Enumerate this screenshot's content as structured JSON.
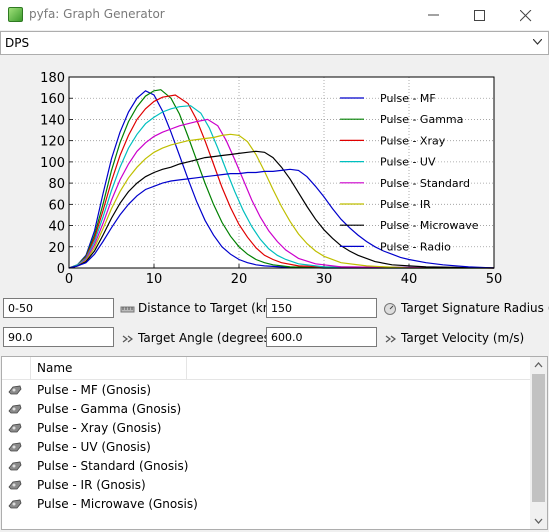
{
  "window": {
    "title": "pyfa: Graph Generator"
  },
  "graph_select": {
    "value": "DPS"
  },
  "colors": {
    "mf": "#0000cc",
    "gamma": "#008000",
    "xray": "#e00000",
    "uv": "#00bfbf",
    "standard": "#cc00cc",
    "ir": "#bfbf00",
    "microwave": "#000000",
    "radio": "#0000cc"
  },
  "chart_data": {
    "type": "line",
    "xlim": [
      0,
      50
    ],
    "ylim": [
      0,
      180
    ],
    "x_ticks": [
      "0",
      "10",
      "20",
      "30",
      "40",
      "50"
    ],
    "y_ticks": [
      "0",
      "20",
      "40",
      "60",
      "80",
      "100",
      "120",
      "140",
      "160",
      "180"
    ],
    "grid": true,
    "legend_position": "top-right",
    "series": [
      {
        "name": "Pulse - MF",
        "color": "#0000cc",
        "points": [
          [
            0,
            0
          ],
          [
            1,
            3
          ],
          [
            2,
            12
          ],
          [
            3,
            35
          ],
          [
            4,
            70
          ],
          [
            5,
            103
          ],
          [
            6,
            128
          ],
          [
            7,
            147
          ],
          [
            8,
            160
          ],
          [
            9,
            167
          ],
          [
            10,
            163
          ],
          [
            11,
            148
          ],
          [
            12,
            128
          ],
          [
            13,
            106
          ],
          [
            14,
            84
          ],
          [
            15,
            63
          ],
          [
            16,
            45
          ],
          [
            17,
            31
          ],
          [
            18,
            20
          ],
          [
            19,
            13
          ],
          [
            20,
            8
          ],
          [
            21,
            5
          ],
          [
            22,
            3
          ],
          [
            23,
            2
          ],
          [
            25,
            1
          ],
          [
            30,
            0
          ],
          [
            50,
            0
          ]
        ]
      },
      {
        "name": "Pulse - Gamma",
        "color": "#008000",
        "points": [
          [
            0,
            0
          ],
          [
            1,
            3
          ],
          [
            2,
            11
          ],
          [
            3,
            31
          ],
          [
            4,
            60
          ],
          [
            5,
            92
          ],
          [
            6,
            118
          ],
          [
            7,
            138
          ],
          [
            8,
            152
          ],
          [
            9,
            162
          ],
          [
            10,
            167
          ],
          [
            10.8,
            168
          ],
          [
            12,
            160
          ],
          [
            13,
            145
          ],
          [
            14,
            124
          ],
          [
            15,
            102
          ],
          [
            16,
            80
          ],
          [
            17,
            60
          ],
          [
            18,
            43
          ],
          [
            19,
            30
          ],
          [
            20,
            20
          ],
          [
            21,
            13
          ],
          [
            22,
            8
          ],
          [
            23,
            5
          ],
          [
            24,
            3
          ],
          [
            26,
            1
          ],
          [
            30,
            0
          ],
          [
            50,
            0
          ]
        ]
      },
      {
        "name": "Pulse - Xray",
        "color": "#e00000",
        "points": [
          [
            0,
            0
          ],
          [
            1,
            3
          ],
          [
            2,
            10
          ],
          [
            3,
            28
          ],
          [
            4,
            54
          ],
          [
            5,
            82
          ],
          [
            6,
            106
          ],
          [
            7,
            125
          ],
          [
            8,
            140
          ],
          [
            9,
            150
          ],
          [
            10,
            157
          ],
          [
            11,
            161
          ],
          [
            12.5,
            163
          ],
          [
            14,
            155
          ],
          [
            15,
            140
          ],
          [
            16,
            120
          ],
          [
            17,
            98
          ],
          [
            18,
            76
          ],
          [
            19,
            57
          ],
          [
            20,
            41
          ],
          [
            21,
            29
          ],
          [
            22,
            19
          ],
          [
            23,
            12
          ],
          [
            24,
            8
          ],
          [
            25,
            5
          ],
          [
            27,
            2
          ],
          [
            30,
            1
          ],
          [
            50,
            0
          ]
        ]
      },
      {
        "name": "Pulse - UV",
        "color": "#00bfbf",
        "points": [
          [
            0,
            0
          ],
          [
            1,
            3
          ],
          [
            2,
            9
          ],
          [
            3,
            25
          ],
          [
            4,
            48
          ],
          [
            5,
            73
          ],
          [
            6,
            95
          ],
          [
            7,
            113
          ],
          [
            8,
            126
          ],
          [
            9,
            136
          ],
          [
            10,
            142
          ],
          [
            11,
            147
          ],
          [
            12,
            150
          ],
          [
            13,
            152
          ],
          [
            14.3,
            153
          ],
          [
            15.5,
            146
          ],
          [
            16.5,
            132
          ],
          [
            17.5,
            113
          ],
          [
            18.5,
            92
          ],
          [
            19.5,
            72
          ],
          [
            20.5,
            54
          ],
          [
            21.5,
            39
          ],
          [
            22.5,
            27
          ],
          [
            23.5,
            18
          ],
          [
            24.5,
            12
          ],
          [
            25.5,
            8
          ],
          [
            27,
            4
          ],
          [
            30,
            1
          ],
          [
            50,
            0
          ]
        ]
      },
      {
        "name": "Pulse - Standard",
        "color": "#cc00cc",
        "points": [
          [
            0,
            0
          ],
          [
            1,
            2
          ],
          [
            2,
            8
          ],
          [
            3,
            22
          ],
          [
            4,
            42
          ],
          [
            5,
            64
          ],
          [
            6,
            83
          ],
          [
            7,
            98
          ],
          [
            8,
            110
          ],
          [
            9,
            118
          ],
          [
            10,
            124
          ],
          [
            11,
            128
          ],
          [
            12,
            131
          ],
          [
            13,
            134
          ],
          [
            14,
            136
          ],
          [
            15,
            138
          ],
          [
            16.3,
            140
          ],
          [
            17.5,
            134
          ],
          [
            18.5,
            120
          ],
          [
            19.5,
            102
          ],
          [
            20.5,
            83
          ],
          [
            21.5,
            64
          ],
          [
            22.5,
            48
          ],
          [
            23.5,
            35
          ],
          [
            24.5,
            25
          ],
          [
            25.5,
            17
          ],
          [
            27,
            9
          ],
          [
            29,
            4
          ],
          [
            32,
            1
          ],
          [
            50,
            0
          ]
        ]
      },
      {
        "name": "Pulse - IR",
        "color": "#bfbf00",
        "points": [
          [
            0,
            0
          ],
          [
            1,
            2
          ],
          [
            2,
            7
          ],
          [
            3,
            19
          ],
          [
            4,
            37
          ],
          [
            5,
            56
          ],
          [
            6,
            72
          ],
          [
            7,
            85
          ],
          [
            8,
            95
          ],
          [
            9,
            103
          ],
          [
            10,
            109
          ],
          [
            11,
            113
          ],
          [
            12,
            116
          ],
          [
            13,
            118
          ],
          [
            14,
            120
          ],
          [
            15,
            121
          ],
          [
            16,
            122
          ],
          [
            17,
            123
          ],
          [
            18,
            125
          ],
          [
            19,
            126
          ],
          [
            20,
            125
          ],
          [
            21,
            119
          ],
          [
            22,
            107
          ],
          [
            23,
            91
          ],
          [
            24,
            74
          ],
          [
            25,
            58
          ],
          [
            26,
            44
          ],
          [
            27,
            32
          ],
          [
            28,
            23
          ],
          [
            29,
            16
          ],
          [
            30,
            11
          ],
          [
            32,
            5
          ],
          [
            35,
            2
          ],
          [
            40,
            0
          ],
          [
            50,
            0
          ]
        ]
      },
      {
        "name": "Pulse - Microwave",
        "color": "#000000",
        "points": [
          [
            0,
            0
          ],
          [
            1,
            2
          ],
          [
            2,
            6
          ],
          [
            3,
            16
          ],
          [
            4,
            31
          ],
          [
            5,
            47
          ],
          [
            6,
            61
          ],
          [
            7,
            72
          ],
          [
            8,
            80
          ],
          [
            9,
            86
          ],
          [
            10,
            90
          ],
          [
            11,
            93
          ],
          [
            12,
            95
          ],
          [
            13,
            98
          ],
          [
            14,
            100
          ],
          [
            15,
            102
          ],
          [
            16,
            104
          ],
          [
            17,
            105
          ],
          [
            18,
            106
          ],
          [
            19,
            107
          ],
          [
            20,
            108
          ],
          [
            21,
            109
          ],
          [
            22,
            110
          ],
          [
            23,
            109
          ],
          [
            24,
            104
          ],
          [
            25,
            95
          ],
          [
            26,
            84
          ],
          [
            27,
            71
          ],
          [
            28,
            58
          ],
          [
            29,
            46
          ],
          [
            30,
            36
          ],
          [
            31,
            28
          ],
          [
            32,
            21
          ],
          [
            33,
            16
          ],
          [
            34,
            12
          ],
          [
            36,
            6
          ],
          [
            38,
            3
          ],
          [
            42,
            1
          ],
          [
            50,
            0
          ]
        ]
      },
      {
        "name": "Pulse - Radio",
        "color": "#0000cc",
        "points": [
          [
            0,
            0
          ],
          [
            1,
            2
          ],
          [
            2,
            5
          ],
          [
            3,
            13
          ],
          [
            4,
            25
          ],
          [
            5,
            38
          ],
          [
            6,
            50
          ],
          [
            7,
            60
          ],
          [
            8,
            68
          ],
          [
            9,
            74
          ],
          [
            10,
            77
          ],
          [
            11,
            80
          ],
          [
            12,
            82
          ],
          [
            13,
            83
          ],
          [
            14,
            84
          ],
          [
            15,
            85
          ],
          [
            16,
            86
          ],
          [
            17,
            87
          ],
          [
            18,
            88
          ],
          [
            19,
            89
          ],
          [
            20,
            89
          ],
          [
            21,
            90
          ],
          [
            22,
            90
          ],
          [
            23,
            91
          ],
          [
            24,
            91
          ],
          [
            25,
            92
          ],
          [
            26,
            93
          ],
          [
            27,
            92
          ],
          [
            28,
            86
          ],
          [
            29,
            77
          ],
          [
            30,
            67
          ],
          [
            31,
            56
          ],
          [
            32,
            46
          ],
          [
            33,
            38
          ],
          [
            34,
            31
          ],
          [
            35,
            25
          ],
          [
            36,
            20
          ],
          [
            37,
            16
          ],
          [
            38,
            13
          ],
          [
            39,
            10
          ],
          [
            40,
            8
          ],
          [
            42,
            5
          ],
          [
            44,
            3
          ],
          [
            47,
            1
          ],
          [
            50,
            0
          ]
        ]
      }
    ]
  },
  "controls": {
    "distance": {
      "value": "0-50",
      "label": "Distance to Target (km)"
    },
    "sig_radius": {
      "value": "150",
      "label": "Target Signature Radius (m)"
    },
    "angle": {
      "value": "90.0",
      "label": "Target Angle (degrees)"
    },
    "velocity": {
      "value": "600.0",
      "label": "Target Velocity (m/s)"
    }
  },
  "fit_list": {
    "header": "Name",
    "rows": [
      "Pulse - MF (Gnosis)",
      "Pulse - Gamma (Gnosis)",
      "Pulse - Xray (Gnosis)",
      "Pulse - UV (Gnosis)",
      "Pulse - Standard (Gnosis)",
      "Pulse - IR (Gnosis)",
      "Pulse - Microwave (Gnosis)"
    ]
  }
}
